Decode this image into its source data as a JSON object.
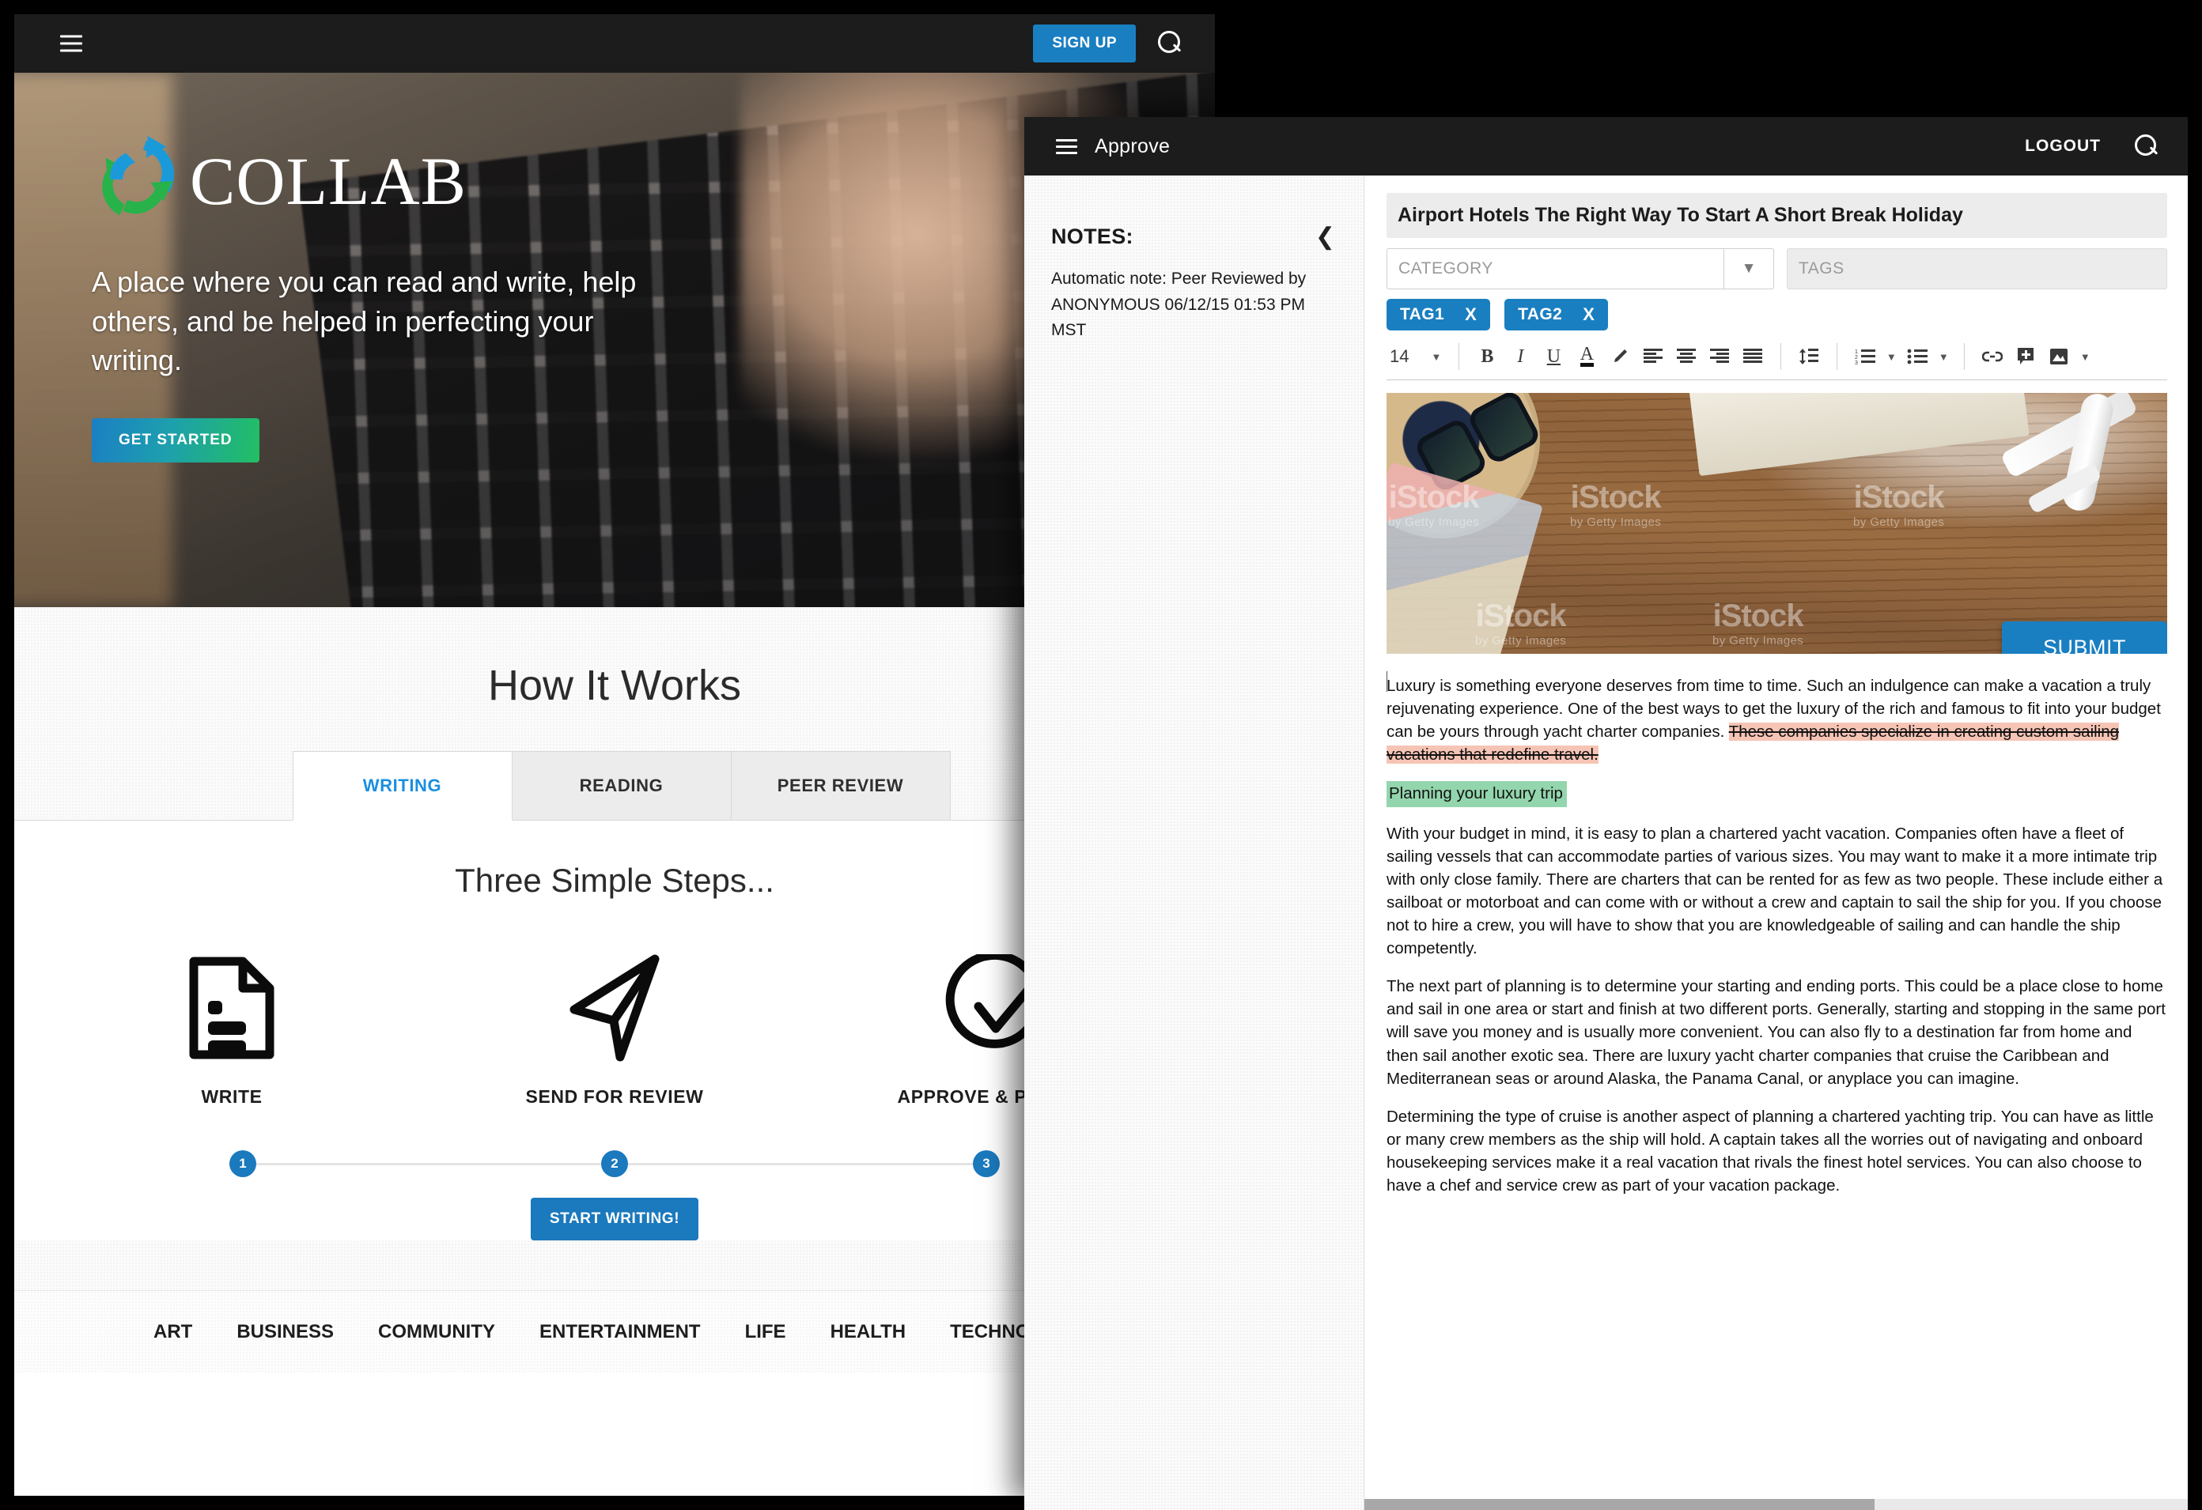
{
  "collab_site": {
    "topbar": {
      "menu_icon": "hamburger-icon",
      "signup_label": "SIGN UP",
      "search_icon": "search-icon"
    },
    "hero": {
      "logo_text": "COLLAB",
      "tagline": "A place where you can read and write, help others, and be helped in perfecting your writing.",
      "cta_label": "GET STARTED"
    },
    "how_it_works": {
      "heading": "How It Works",
      "tabs": [
        {
          "label": "WRITING",
          "active": true
        },
        {
          "label": "READING",
          "active": false
        },
        {
          "label": "PEER REVIEW",
          "active": false
        }
      ],
      "panel_heading": "Three Simple Steps...",
      "steps": [
        {
          "number": "1",
          "label": "WRITE",
          "icon": "document-icon"
        },
        {
          "number": "2",
          "label": "SEND FOR REVIEW",
          "icon": "paper-plane-icon"
        },
        {
          "number": "3",
          "label": "APPROVE & PUBLISH",
          "icon": "check-circle-icon"
        }
      ],
      "cta_label": "START WRITING!"
    },
    "footer_nav": [
      "ART",
      "BUSINESS",
      "COMMUNITY",
      "ENTERTAINMENT",
      "LIFE",
      "HEALTH",
      "TECHNOLOGY"
    ]
  },
  "approve_app": {
    "topbar": {
      "menu_icon": "hamburger-icon",
      "title": "Approve",
      "logout_label": "LOGOUT",
      "search_icon": "search-icon"
    },
    "notes": {
      "heading": "NOTES:",
      "collapse_icon": "chevron-left-icon",
      "items": [
        "Automatic note: Peer Reviewed by ANONYMOUS 06/12/15 01:53 PM MST"
      ]
    },
    "editor": {
      "title_value": "Airport Hotels The Right Way To Start A Short Break Holiday",
      "category_placeholder": "CATEGORY",
      "category_caret_icon": "chevron-down-icon",
      "tags_placeholder": "TAGS",
      "tag_chips": [
        {
          "label": "TAG1",
          "remove_icon": "X"
        },
        {
          "label": "TAG2",
          "remove_icon": "X"
        }
      ],
      "toolbar": {
        "font_size": "14",
        "font_size_caret": "▾",
        "buttons": [
          {
            "name": "bold-icon",
            "glyph": "B"
          },
          {
            "name": "italic-icon",
            "glyph": "I"
          },
          {
            "name": "underline-icon",
            "glyph": "U"
          },
          {
            "name": "text-color-icon",
            "glyph": "A"
          },
          {
            "name": "highlighter-icon",
            "glyph": "pen"
          },
          {
            "name": "align-left-icon",
            "glyph": "align-left"
          },
          {
            "name": "align-center-icon",
            "glyph": "align-center"
          },
          {
            "name": "align-right-icon",
            "glyph": "align-right"
          },
          {
            "name": "align-justify-icon",
            "glyph": "align-justify"
          },
          {
            "name": "line-height-icon",
            "glyph": "line-height"
          },
          {
            "name": "numbered-list-icon",
            "glyph": "123"
          },
          {
            "name": "bulleted-list-icon",
            "glyph": "bullets"
          },
          {
            "name": "link-icon",
            "glyph": "chain"
          },
          {
            "name": "insert-icon",
            "glyph": "plus"
          },
          {
            "name": "image-icon",
            "glyph": "picture"
          }
        ]
      },
      "image": {
        "alt": "Travel flat lay with straw hat, sunglasses, map and toy airplane on wooden table",
        "watermark_brand": "iStock",
        "watermark_sub": "by Getty Images"
      },
      "submit_label": "SUBMIT",
      "content": {
        "paragraph_1_plain": "Luxury is something everyone deserves from time to time. Such an indulgence can make a vacation a truly rejuvenating experience. One of the best ways to get the luxury of the rich and famous to fit into your budget can be yours through yacht charter companies. ",
        "paragraph_1_struck": "These companies specialize in creating custom sailing vacations that redefine travel. ",
        "heading_highlight": "Planning your luxury trip",
        "paragraph_2": "With your budget in mind, it is easy to plan a chartered yacht vacation. Companies often have a fleet of sailing vessels that can accommodate parties of various sizes. You may want to make it a more intimate trip with only close family. There are charters that can be rented for as few as two people. These include either a sailboat or motorboat and can come with or without a crew and captain to sail the ship for you. If you choose not to hire a crew, you will have to show that you are knowledgeable of sailing and can handle the ship competently.",
        "paragraph_3": "The next part of planning is to determine your starting and ending ports. This could be a place close to home and sail in one area or start and finish at two different ports. Generally, starting and stopping in the same port will save you money and is usually more convenient. You can also fly to a destination far from home and then sail another exotic sea. There are luxury yacht charter companies that cruise the Caribbean and Mediterranean seas or around Alaska, the Panama Canal, or anyplace you can imagine.",
        "paragraph_4": "Determining the type of cruise is another aspect of planning a chartered yachting trip. You can have as little or many crew members as the ship will hold. A captain takes all the worries out of navigating and onboard housekeeping services make it a real vacation that rivals the finest hotel services. You can also choose to have a chef and service crew as part of your vacation package."
      }
    }
  },
  "colors": {
    "brand_blue": "#1a7fc1",
    "dark_header": "#1c1c1c",
    "tab_active_text": "#1a8fe0",
    "strike_highlight_pink": "#f6c4b5",
    "heading_highlight_green": "#93d5ad",
    "page_background": "#000000"
  }
}
